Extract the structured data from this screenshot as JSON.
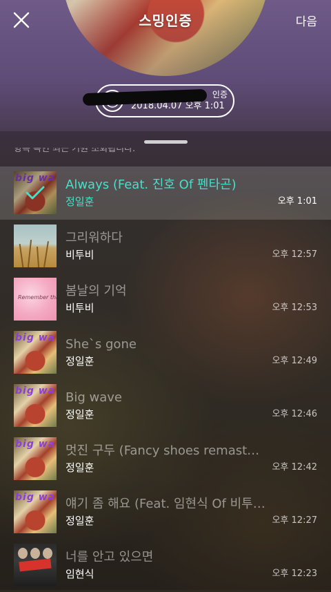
{
  "header": {
    "title": "스밍인증",
    "next_label": "다음",
    "record": {
      "label": "인증",
      "datetime": "2018.04.07 오후 1:01"
    }
  },
  "sheet": {
    "hint": "항목 독인 최근 기원 조회됩니다."
  },
  "songs": [
    {
      "title": "Always (Feat. 진호 Of 펜타곤)",
      "artist": "정일훈",
      "time": "오후 1:01",
      "art": "bigwave",
      "art_text": "big wave",
      "selected": true
    },
    {
      "title": "그리워하다",
      "artist": "비투비",
      "time": "오후 12:57",
      "art": "field",
      "selected": false
    },
    {
      "title": "봄날의 기억",
      "artist": "비투비",
      "time": "오후 12:53",
      "art": "pink",
      "art_text": "Remember that",
      "selected": false
    },
    {
      "title": "She`s gone",
      "artist": "정일훈",
      "time": "오후 12:49",
      "art": "bigwave",
      "art_text": "big wave",
      "selected": false
    },
    {
      "title": "Big wave",
      "artist": "정일훈",
      "time": "오후 12:46",
      "art": "bigwave",
      "art_text": "big wave",
      "selected": false
    },
    {
      "title": "멋진 구두 (Fancy shoes remastered)",
      "artist": "정일훈",
      "time": "오후 12:42",
      "art": "bigwave",
      "art_text": "big wave",
      "selected": false
    },
    {
      "title": "얘기 좀 해요 (Feat. 임현식 Of 비투비)",
      "artist": "정일훈",
      "time": "오후 12:27",
      "art": "bigwave",
      "art_text": "big wave",
      "selected": false
    },
    {
      "title": "너를 안고 있으면",
      "artist": "임현식",
      "time": "오후 12:23",
      "art": "photo",
      "selected": false
    }
  ],
  "colors": {
    "accent": "#46e0c8",
    "header_purple": "#6f5a88"
  },
  "icons": {
    "close": "close-icon",
    "disc": "disc-icon",
    "check": "checkmark-icon"
  }
}
